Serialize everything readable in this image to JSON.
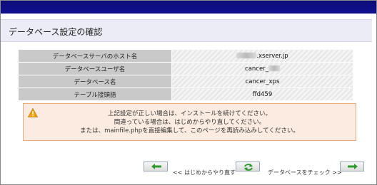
{
  "header": {
    "title": "データベース設定の確認"
  },
  "info_table": {
    "rows": [
      {
        "label": "データベースサーバのホスト名",
        "value": ".xserver.jp"
      },
      {
        "label": "データベースユーザ名",
        "value": "cancer_"
      },
      {
        "label": "データベース名",
        "value": "cancer_xps"
      },
      {
        "label": "テーブル接頭語",
        "value": "ffd459"
      }
    ]
  },
  "warning": {
    "icon": "warning-triangle-icon",
    "lines": [
      "上記設定が正しい場合は、インストールを続けてください。",
      "間違っている場合は、はじめからやり直してください。",
      "または、mainfile.phpを直接編集して、このページを再読み込みしてください。"
    ]
  },
  "nav": {
    "back_label": "<< はじめからやり直す",
    "recheck_label": "データベースをチェック >>"
  },
  "colors": {
    "topbar": "#0c0c78",
    "warning_bg": "#fbebe0",
    "warning_border": "#e6a982",
    "icon_green": "#2e9a2e"
  }
}
